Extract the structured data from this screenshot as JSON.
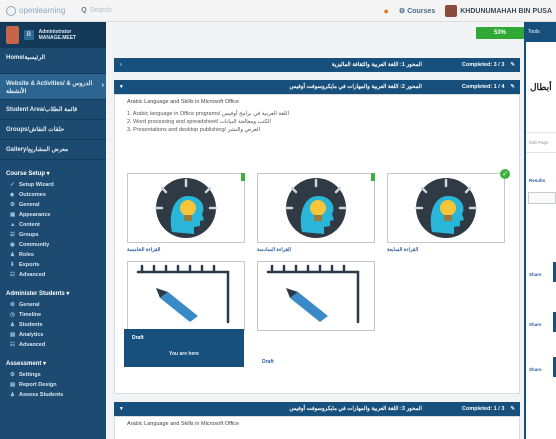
{
  "topbar": {
    "logo_text": "openlearning",
    "search_label": "Q",
    "search_placeholder": "Search",
    "courses_label": "Courses",
    "user_name": "KHDUNUMAHAH BIN PUSA"
  },
  "sidebar": {
    "user_label": "Administrator MANAGE.MEET",
    "home": "Home/الرئيسية",
    "website": "Website & Activities/ الدروس & الأنشطة",
    "students": "Student Area/قائمة الطلاب",
    "groups": "Groups/حلقات النقاش",
    "gallery": "Gallery/معرض المشاريع",
    "course_setup": "Course Setup ▾",
    "setup_items": [
      {
        "icon": "✓",
        "label": "Setup Wizard"
      },
      {
        "icon": "◆",
        "label": "Outcomes"
      },
      {
        "icon": "⚙",
        "label": "General"
      },
      {
        "icon": "▣",
        "label": "Appearance"
      },
      {
        "icon": "▲",
        "label": "Content"
      },
      {
        "icon": "☰",
        "label": "Groups"
      },
      {
        "icon": "◉",
        "label": "Community"
      },
      {
        "icon": "♟",
        "label": "Roles"
      },
      {
        "icon": "⬇",
        "label": "Exports"
      },
      {
        "icon": "☷",
        "label": "Advanced"
      }
    ],
    "admin_students": "Administer Students ▾",
    "admin_items": [
      {
        "icon": "⚙",
        "label": "General"
      },
      {
        "icon": "◷",
        "label": "Timeline"
      },
      {
        "icon": "♟",
        "label": "Students"
      },
      {
        "icon": "▤",
        "label": "Analytics"
      },
      {
        "icon": "☷",
        "label": "Advanced"
      }
    ],
    "assessment": "Assessment ▾",
    "assessment_items": [
      {
        "icon": "⚙",
        "label": "Settings"
      },
      {
        "icon": "▤",
        "label": "Report Design"
      },
      {
        "icon": "♟",
        "label": "Assess Students"
      }
    ]
  },
  "progress": {
    "label": "53%",
    "value": 0.53
  },
  "lessons": [
    {
      "title": "المحور 1: اللغة العربية والثقافة الماليزية",
      "status": "Completed: 3 / 3"
    },
    {
      "title": "المحور 2: اللغة العربية والمهارات في مايكروسوفت أوفيس",
      "status": "Completed: 1 / 4"
    },
    {
      "title": "المحور 3: اللغة العربية والمهارات في مايكروسوفت أوفيس",
      "status": "Completed: 1 / 3"
    }
  ],
  "lesson_content": {
    "intro": "Arabic Language and Skills in Microsoft Office",
    "objectives": [
      "1. Arabic language in Office programs/ اللغة العربية في برامج أوفيس",
      "2. Word processing and spreadsheet/ الكتب ومعالجة البيانات",
      "3. Presentations and desktop publishing/ العرض والنشر"
    ]
  },
  "cards": [
    {
      "label": "القراءة الخامسة"
    },
    {
      "label": "القراءة السادسة"
    },
    {
      "label": "القراءة السابعة"
    }
  ],
  "draft": {
    "label": "Draft",
    "you_are_here": "You are here"
  },
  "second_intro": "Arabic Language and Skills in Microsoft Office",
  "right_panel": {
    "tab": "Tools",
    "title": "أبطال",
    "edit_page": "Edit Page",
    "results": "Results",
    "links": [
      "Share",
      "Share",
      "Share"
    ]
  },
  "colors": {
    "sidebar": "#1d4a70",
    "accent": "#17507c",
    "progress": "#2fa836"
  }
}
